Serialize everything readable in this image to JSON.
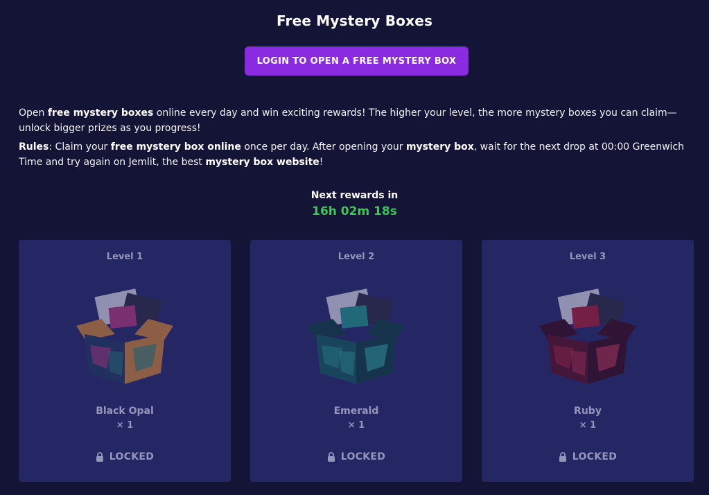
{
  "header": {
    "title": "Free Mystery Boxes",
    "login_button": "LOGIN TO OPEN A FREE MYSTERY BOX"
  },
  "description": {
    "p1": [
      {
        "t": "Open ",
        "b": false
      },
      {
        "t": "free mystery boxes",
        "b": true
      },
      {
        "t": " online every day and win exciting rewards! The higher your level, the more mystery boxes you can claim—unlock bigger prizes as you progress!",
        "b": false
      }
    ],
    "p2": [
      {
        "t": "Rules",
        "b": true
      },
      {
        "t": ": Claim your ",
        "b": false
      },
      {
        "t": "free mystery box online",
        "b": true
      },
      {
        "t": " once per day. After opening your ",
        "b": false
      },
      {
        "t": "mystery box",
        "b": true
      },
      {
        "t": ", wait for the next drop at 00:00 Greenwich Time and try again on Jemlit, the best ",
        "b": false
      },
      {
        "t": "mystery box website",
        "b": true
      },
      {
        "t": "!",
        "b": false
      }
    ]
  },
  "rewards": {
    "label": "Next rewards in",
    "timer": "16h 02m 18s",
    "timer_color": "#3fc55a"
  },
  "cards": [
    {
      "level": "Level 1",
      "name": "Black Opal",
      "qty": "× 1",
      "status": "LOCKED",
      "gem_colors": [
        "#1c3a5c",
        "#c0397a",
        "#e08b2b",
        "#2d8f7a"
      ]
    },
    {
      "level": "Level 2",
      "name": "Emerald",
      "qty": "× 1",
      "status": "LOCKED",
      "gem_colors": [
        "#0f5e55",
        "#1f9e88",
        "#0a3d38",
        "#2cc1a2"
      ]
    },
    {
      "level": "Level 3",
      "name": "Ruby",
      "qty": "× 1",
      "status": "LOCKED",
      "gem_colors": [
        "#5e0b18",
        "#b31a2e",
        "#3a0610",
        "#e0344a"
      ]
    }
  ],
  "colors": {
    "background": "#141536",
    "card": "#252765",
    "accent": "#8a2be2",
    "muted_text": "#9596bb"
  }
}
